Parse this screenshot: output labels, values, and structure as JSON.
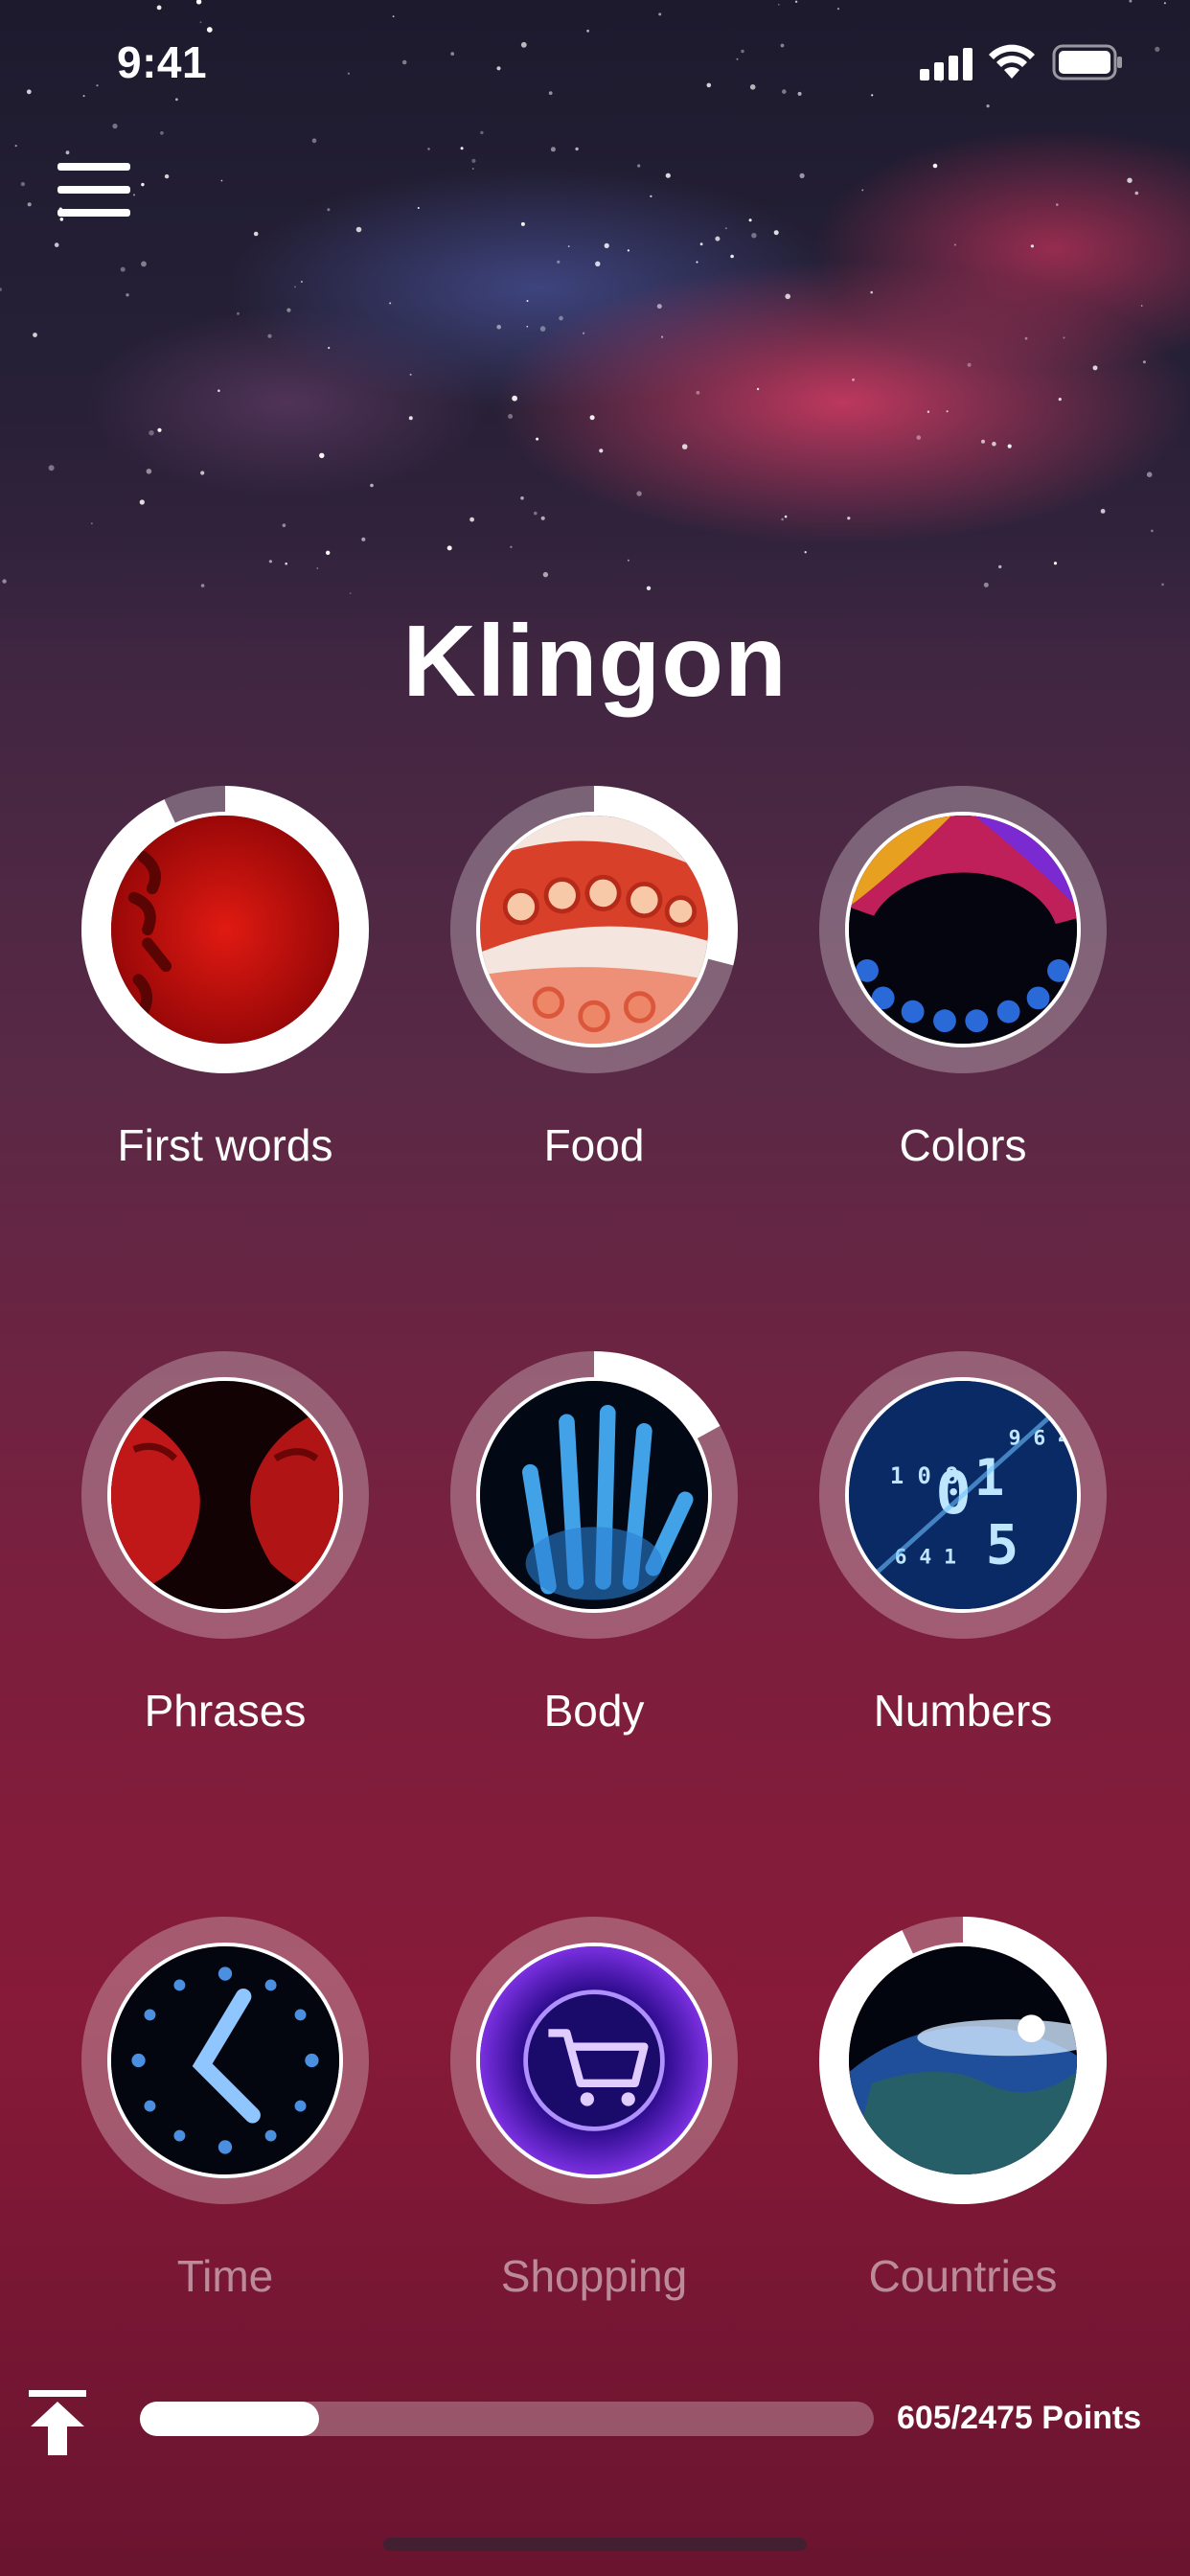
{
  "status_bar": {
    "time": "9:41"
  },
  "header": {
    "title": "Klingon"
  },
  "icons": {
    "menu": "hamburger-menu-icon",
    "scroll_top": "arrow-up-to-top-icon",
    "signal": "cellular-signal-icon",
    "wifi": "wifi-icon",
    "battery": "battery-icon"
  },
  "categories": [
    {
      "label": "First words",
      "progress": 0.93,
      "locked": false,
      "image": "red-klingon-script"
    },
    {
      "label": "Food",
      "progress": 0.29,
      "locked": false,
      "image": "octopus-tentacle"
    },
    {
      "label": "Colors",
      "progress": 0,
      "locked": false,
      "image": "spectrum-dots"
    },
    {
      "label": "Phrases",
      "progress": 0,
      "locked": false,
      "image": "klingon-faces-red"
    },
    {
      "label": "Body",
      "progress": 0.17,
      "locked": false,
      "image": "xray-hand"
    },
    {
      "label": "Numbers",
      "progress": 0,
      "locked": false,
      "image": "digital-numbers"
    },
    {
      "label": "Time",
      "progress": 0,
      "locked": true,
      "image": "digital-clock"
    },
    {
      "label": "Shopping",
      "progress": 0,
      "locked": true,
      "image": "shopping-cart"
    },
    {
      "label": "Countries",
      "progress": 0.93,
      "locked": true,
      "image": "earth-from-space"
    }
  ],
  "footer": {
    "points_text": "605/2475 Points",
    "points_current": 605,
    "points_total": 2475
  },
  "colors": {
    "ring_track": "rgba(255,255,255,0.28)",
    "ring_progress": "#ffffff",
    "background_top": "#241a33",
    "background_bottom": "#861a38"
  }
}
